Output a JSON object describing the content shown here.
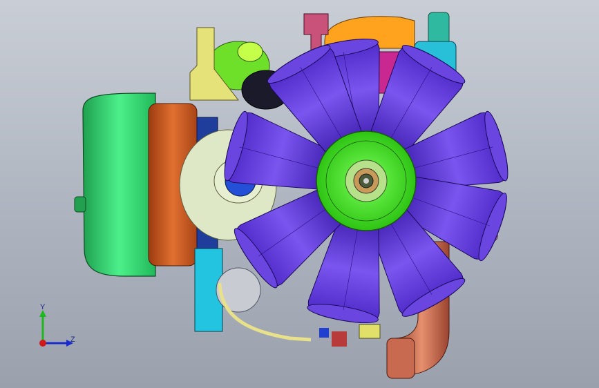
{
  "viewport": {
    "background_top": "#c9ced6",
    "background_bottom": "#9aa1ad"
  },
  "model": {
    "name_visible": false,
    "colors": {
      "fan_blade": "#5a2fd6",
      "fan_blade_light": "#8c6cf0",
      "fan_hub": "#3ee01c",
      "oil_pan": "#27d86a",
      "flywheel_housing": "#c85a1e",
      "manifold": "#c8288f",
      "turbo": "#ff9f1a",
      "intake_pipe": "#c86a50",
      "bracket": "#e6e27a",
      "hose": "#e8e08a",
      "cyan_parts": "#22c4e0"
    }
  },
  "triad": {
    "x_label": "",
    "y_label": "Y",
    "z_label": "Z",
    "y_color": "#1fb81f",
    "z_color": "#1a2acc",
    "x_color": "#d01a1a"
  }
}
